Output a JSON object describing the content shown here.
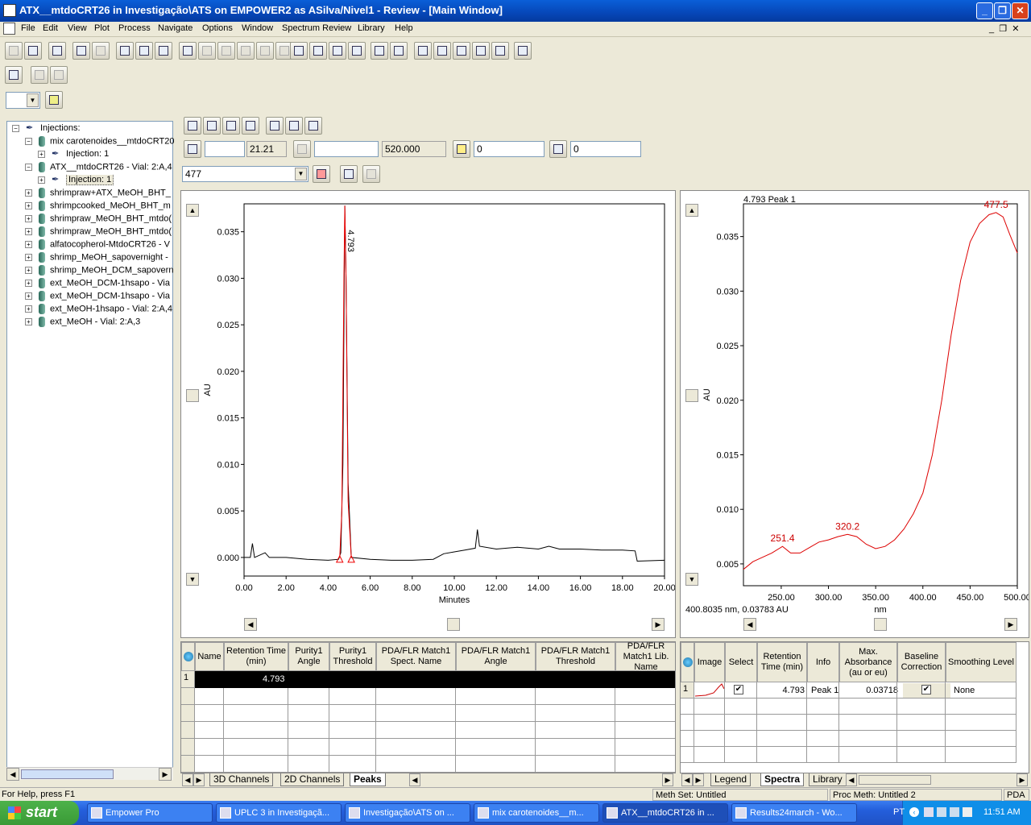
{
  "window": {
    "title": "ATX__mtdoCRT26 in Investigação\\ATS on EMPOWER2 as ASilva/Nivel1 - Review - [Main Window]"
  },
  "menu": [
    "File",
    "Edit",
    "View",
    "Plot",
    "Process",
    "Navigate",
    "Options",
    "Window",
    "Spectrum Review",
    "Library",
    "Help"
  ],
  "tree": {
    "root": "Injections:",
    "items": [
      {
        "label": "mix carotenoides__mtdoCRT20",
        "level": 1,
        "exp": "−",
        "type": "vial"
      },
      {
        "label": "Injection: 1",
        "level": 2,
        "exp": "+",
        "type": "inj"
      },
      {
        "label": "ATX__mtdoCRT26 - Vial: 2:A,4",
        "level": 1,
        "exp": "−",
        "type": "vial"
      },
      {
        "label": "Injection: 1",
        "level": 2,
        "exp": "+",
        "type": "inj",
        "selected": true
      },
      {
        "label": "shrimpraw+ATX_MeOH_BHT_",
        "level": 1,
        "exp": "+",
        "type": "vial"
      },
      {
        "label": "shrimpcooked_MeOH_BHT_m",
        "level": 1,
        "exp": "+",
        "type": "vial"
      },
      {
        "label": "shrimpraw_MeOH_BHT_mtdo(",
        "level": 1,
        "exp": "+",
        "type": "vial"
      },
      {
        "label": "shrimpraw_MeOH_BHT_mtdo(",
        "level": 1,
        "exp": "+",
        "type": "vial"
      },
      {
        "label": "alfatocopherol-MtdoCRT26 - V",
        "level": 1,
        "exp": "+",
        "type": "vial"
      },
      {
        "label": "shrimp_MeOH_sapovernight - ",
        "level": 1,
        "exp": "+",
        "type": "vial"
      },
      {
        "label": "shrimp_MeOH_DCM_sapovern",
        "level": 1,
        "exp": "+",
        "type": "vial"
      },
      {
        "label": "ext_MeOH_DCM-1hsapo - Via",
        "level": 1,
        "exp": "+",
        "type": "vial"
      },
      {
        "label": "ext_MeOH_DCM-1hsapo - Via",
        "level": 1,
        "exp": "+",
        "type": "vial"
      },
      {
        "label": "ext_MeOH-1hsapo - Vial: 2:A,4",
        "level": 1,
        "exp": "+",
        "type": "vial"
      },
      {
        "label": "ext_MeOH - Vial: 2:A,3",
        "level": 1,
        "exp": "+",
        "type": "vial"
      }
    ]
  },
  "fields": {
    "f1": "",
    "f2": "21.21",
    "f3": "",
    "f4": "520.000",
    "f5": "0",
    "f6": "0",
    "channel": "477"
  },
  "chart_data": [
    {
      "type": "line",
      "xlabel": "Minutes",
      "ylabel": "AU",
      "xlim": [
        0,
        20
      ],
      "ylim": [
        -0.002,
        0.038
      ],
      "xticks": [
        "0.00",
        "2.00",
        "4.00",
        "6.00",
        "8.00",
        "10.00",
        "12.00",
        "14.00",
        "16.00",
        "18.00",
        "20.00"
      ],
      "yticks": [
        "0.000",
        "0.005",
        "0.010",
        "0.015",
        "0.020",
        "0.025",
        "0.030",
        "0.035"
      ],
      "peak_label": "4.793",
      "series": [
        {
          "values": [
            [
              0,
              0.0
            ],
            [
              0.3,
              0.0
            ],
            [
              0.4,
              0.0015
            ],
            [
              0.5,
              0.0
            ],
            [
              1.0,
              0.0005
            ],
            [
              1.2,
              0.0
            ],
            [
              2.0,
              0.0
            ],
            [
              3.0,
              -0.0002
            ],
            [
              4.0,
              -0.0003
            ],
            [
              4.5,
              -0.0002
            ],
            [
              4.6,
              0.0005
            ],
            [
              4.7,
              0.01
            ],
            [
              4.793,
              0.0378
            ],
            [
              4.85,
              0.03
            ],
            [
              4.95,
              0.008
            ],
            [
              5.1,
              0.0
            ],
            [
              6,
              -0.0002
            ],
            [
              7,
              -0.0003
            ],
            [
              8,
              -0.0003
            ],
            [
              9,
              -0.0002
            ],
            [
              9.5,
              0.0004
            ],
            [
              10,
              0.0006
            ],
            [
              10.5,
              0.0008
            ],
            [
              11,
              0.001
            ],
            [
              11.1,
              0.003
            ],
            [
              11.2,
              0.0012
            ],
            [
              12,
              0.0009
            ],
            [
              13,
              0.0011
            ],
            [
              14,
              0.0009
            ],
            [
              14.5,
              0.0012
            ],
            [
              15,
              0.0009
            ],
            [
              16,
              0.0009
            ],
            [
              17,
              0.0008
            ],
            [
              18,
              0.0008
            ],
            [
              18.6,
              0.0007
            ],
            [
              18.7,
              -0.0004
            ],
            [
              20,
              -0.0003
            ]
          ]
        },
        {
          "values": [
            [
              4.55,
              0.0
            ],
            [
              4.65,
              0.005
            ],
            [
              4.75,
              0.03
            ],
            [
              4.793,
              0.0378
            ],
            [
              4.85,
              0.03
            ],
            [
              4.95,
              0.006
            ],
            [
              5.1,
              0.0
            ]
          ]
        }
      ]
    },
    {
      "type": "line",
      "title": "4.793 Peak 1",
      "xlabel": "nm",
      "ylabel": "AU",
      "xlim": [
        210,
        500
      ],
      "ylim": [
        0.003,
        0.038
      ],
      "xticks": [
        "250.00",
        "300.00",
        "350.00",
        "400.00",
        "450.00",
        "500.00"
      ],
      "yticks": [
        "0.005",
        "0.010",
        "0.015",
        "0.020",
        "0.025",
        "0.030",
        "0.035"
      ],
      "annotations": [
        "251.4",
        "320.2",
        "477.5"
      ],
      "series": [
        {
          "values": [
            [
              210,
              0.0045
            ],
            [
              220,
              0.0052
            ],
            [
              230,
              0.0056
            ],
            [
              240,
              0.006
            ],
            [
              251.4,
              0.0066
            ],
            [
              260,
              0.006
            ],
            [
              270,
              0.006
            ],
            [
              280,
              0.0065
            ],
            [
              290,
              0.007
            ],
            [
              300,
              0.0072
            ],
            [
              310,
              0.0075
            ],
            [
              320.2,
              0.0077
            ],
            [
              330,
              0.0075
            ],
            [
              340,
              0.0068
            ],
            [
              350,
              0.0064
            ],
            [
              360,
              0.0066
            ],
            [
              370,
              0.0072
            ],
            [
              380,
              0.0082
            ],
            [
              390,
              0.0096
            ],
            [
              400,
              0.0115
            ],
            [
              410,
              0.015
            ],
            [
              420,
              0.02
            ],
            [
              430,
              0.026
            ],
            [
              440,
              0.031
            ],
            [
              450,
              0.0345
            ],
            [
              460,
              0.0362
            ],
            [
              470,
              0.037
            ],
            [
              477.5,
              0.0372
            ],
            [
              485,
              0.0368
            ],
            [
              492,
              0.0352
            ],
            [
              500,
              0.0335
            ]
          ]
        }
      ]
    }
  ],
  "spectrum_cursor": "400.8035 nm, 0.03783 AU",
  "peaks_table": {
    "headers": [
      "Name",
      "Retention Time (min)",
      "Purity1 Angle",
      "Purity1 Threshold",
      "PDA/FLR Match1 Spect. Name",
      "PDA/FLR Match1 Angle",
      "PDA/FLR Match1 Threshold",
      "PDA/FLR Match1 Lib. Name"
    ],
    "rows": [
      {
        "index": "1",
        "name": "",
        "rt": "4.793"
      }
    ]
  },
  "spectra_table": {
    "headers": [
      "Image",
      "Select",
      "Retention Time (min)",
      "Info",
      "Max. Absorbance (au or eu)",
      "Baseline Correction",
      "Smoothing Level"
    ],
    "rows": [
      {
        "index": "1",
        "rt": "4.793",
        "info": "Peak 1",
        "maxabs": "0.03718",
        "smoothing": "None"
      }
    ]
  },
  "left_tabs": [
    "3D Channels",
    "2D Channels",
    "Peaks"
  ],
  "right_tabs": [
    "Legend",
    "Spectra",
    "Library"
  ],
  "status": {
    "help": "For Help, press F1",
    "methset": "Meth Set: Untitled",
    "procmeth": "Proc Meth: Untitled 2",
    "mode": "PDA"
  },
  "taskbar": {
    "start": "start",
    "tasks": [
      "Empower Pro",
      "UPLC 3 in Investigaçã...",
      "Investigação\\ATS on ...",
      "mix carotenoides__m...",
      "ATX__mtdoCRT26 in ...",
      "Results24march - Wo..."
    ],
    "lang": "PT",
    "clock": "11:51 AM"
  }
}
